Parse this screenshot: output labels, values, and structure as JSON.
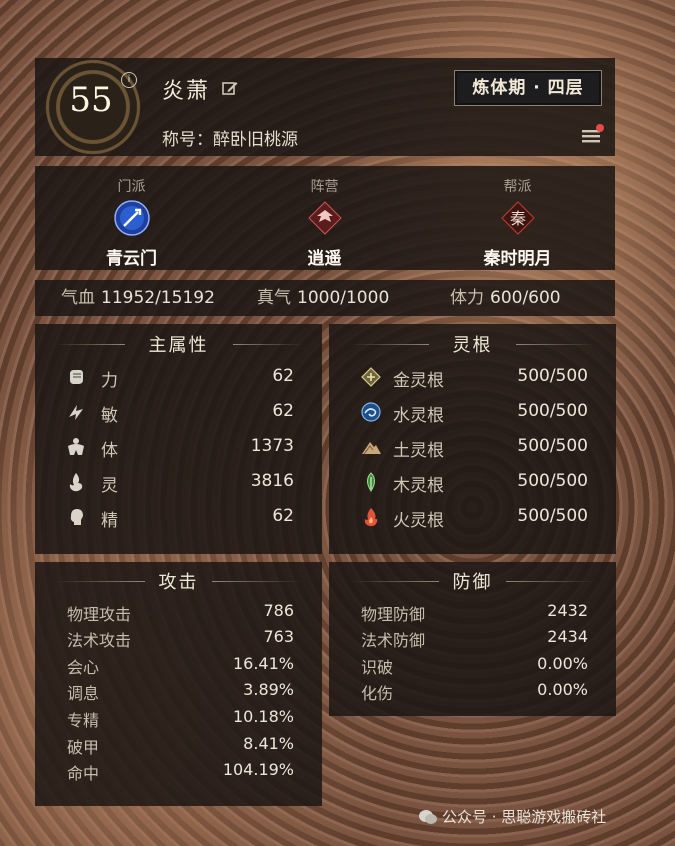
{
  "header": {
    "level": "55",
    "info_icon": "i",
    "name": "炎萧",
    "realm": "炼体期 · 四层",
    "title_label": "称号：",
    "title_value": "醉卧旧桃源"
  },
  "factions": [
    {
      "label": "门派",
      "value": "青云门",
      "icon": "spear-emblem-icon",
      "color": "#2b5fd1"
    },
    {
      "label": "阵营",
      "value": "逍遥",
      "icon": "wings-emblem-icon",
      "color": "#8f2b2b"
    },
    {
      "label": "帮派",
      "value": "秦时明月",
      "icon_text": "秦",
      "color": "#a52a22"
    }
  ],
  "stats_bar": [
    {
      "label": "气血",
      "value": "11952/15192"
    },
    {
      "label": "真气",
      "value": "1000/1000"
    },
    {
      "label": "体力",
      "value": "600/600"
    }
  ],
  "primary": {
    "title": "主属性",
    "rows": [
      {
        "label": "力",
        "value": "62",
        "icon": "fist-icon"
      },
      {
        "label": "敏",
        "value": "62",
        "icon": "swift-icon"
      },
      {
        "label": "体",
        "value": "1373",
        "icon": "body-icon"
      },
      {
        "label": "灵",
        "value": "3816",
        "icon": "spirit-flame-icon"
      },
      {
        "label": "精",
        "value": "62",
        "icon": "head-icon"
      }
    ]
  },
  "roots": {
    "title": "灵根",
    "rows": [
      {
        "label": "金灵根",
        "value": "500/500",
        "icon": "metal-icon",
        "color": "#b8a56a"
      },
      {
        "label": "水灵根",
        "value": "500/500",
        "icon": "water-icon",
        "color": "#5a9bd8"
      },
      {
        "label": "土灵根",
        "value": "500/500",
        "icon": "earth-icon",
        "color": "#c8a67a"
      },
      {
        "label": "木灵根",
        "value": "500/500",
        "icon": "wood-icon",
        "color": "#6bb86a"
      },
      {
        "label": "火灵根",
        "value": "500/500",
        "icon": "fire-icon",
        "color": "#e0553a"
      }
    ]
  },
  "attack": {
    "title": "攻击",
    "rows": [
      {
        "label": "物理攻击",
        "value": "786"
      },
      {
        "label": "法术攻击",
        "value": "763"
      },
      {
        "label": "会心",
        "value": "16.41%"
      },
      {
        "label": "调息",
        "value": "3.89%"
      },
      {
        "label": "专精",
        "value": "10.18%"
      },
      {
        "label": "破甲",
        "value": "8.41%"
      },
      {
        "label": "命中",
        "value": "104.19%"
      }
    ]
  },
  "defense": {
    "title": "防御",
    "rows": [
      {
        "label": "物理防御",
        "value": "2432"
      },
      {
        "label": "法术防御",
        "value": "2434"
      },
      {
        "label": "识破",
        "value": "0.00%"
      },
      {
        "label": "化伤",
        "value": "0.00%"
      }
    ]
  },
  "watermark": "公众号 · 思聪游戏搬砖社"
}
